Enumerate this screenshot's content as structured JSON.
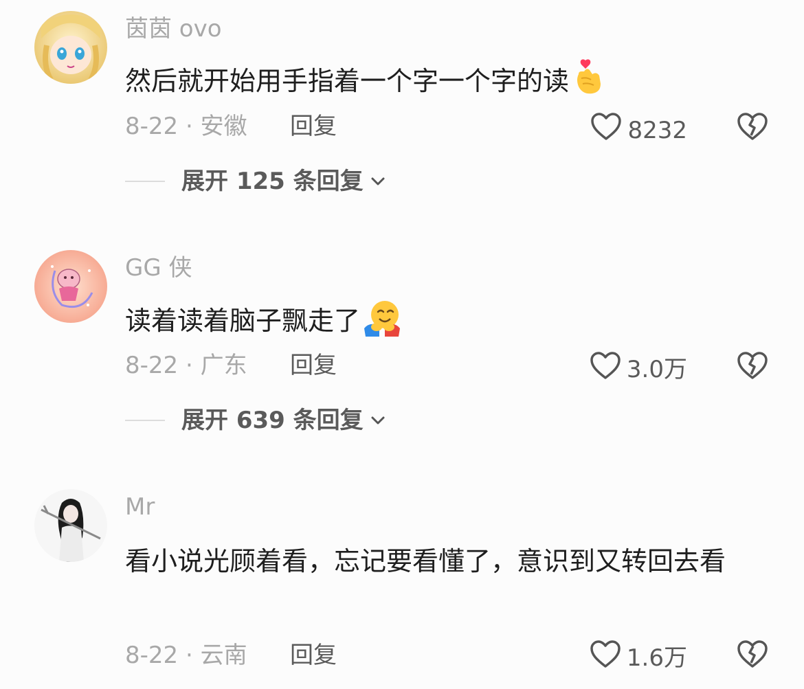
{
  "comments": [
    {
      "username": "茵茵 ovo",
      "text": "然后就开始用手指着一个字一个字的读",
      "emoji": "finger-heart",
      "date": "8-22 · 安徽",
      "reply": "回复",
      "likes": "8232",
      "expand": "展开 125 条回复"
    },
    {
      "username": "GG 侠",
      "text": "读着读着脑子飘走了",
      "emoji": "hugging-face",
      "date": "8-22 · 广东",
      "reply": "回复",
      "likes": "3.0万",
      "expand": "展开 639 条回复"
    },
    {
      "username": "Mr",
      "text": "看小说光顾着看，忘记要看懂了，意识到又转回去看",
      "date": "8-22 · 云南",
      "reply": "回复",
      "likes": "1.6万"
    }
  ]
}
